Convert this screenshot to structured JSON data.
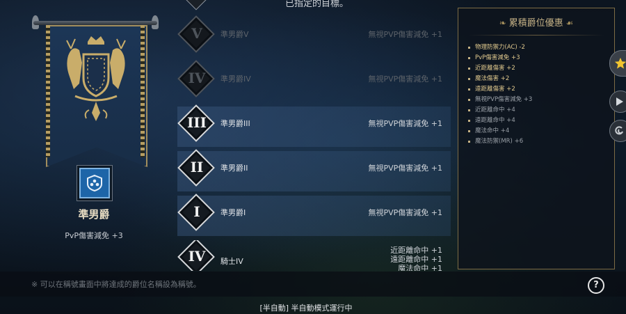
{
  "top": {
    "partial_text": "已指定的目標。"
  },
  "banner": {
    "rank_name": "準男爵",
    "rank_bonus": "PvP傷害減免 +3"
  },
  "ranks": [
    {
      "numeral": "V",
      "title": "準男爵V",
      "value": "無視PVP傷害減免 +1",
      "state": "dim"
    },
    {
      "numeral": "IV",
      "title": "準男爵IV",
      "value": "無視PVP傷害減免 +1",
      "state": "dim"
    },
    {
      "numeral": "III",
      "title": "準男爵III",
      "value": "無視PVP傷害減免 +1",
      "state": "active"
    },
    {
      "numeral": "II",
      "title": "準男爵II",
      "value": "無視PVP傷害減免 +1",
      "state": "active"
    },
    {
      "numeral": "I",
      "title": "準男爵I",
      "value": "無視PVP傷害減免 +1",
      "state": "active"
    },
    {
      "numeral": "IV",
      "title": "騎士IV",
      "value_lines": [
        "近距離命中 +1",
        "遠距離命中 +1",
        "魔法命中 +1"
      ],
      "state": "normal"
    }
  ],
  "panel": {
    "title": "累積爵位優惠",
    "items": [
      {
        "text": "物理防禦力(AC) -2",
        "tone": "gold"
      },
      {
        "text": "PvP傷害減免 +3",
        "tone": "gold"
      },
      {
        "text": "近距離傷害 +2",
        "tone": "gold"
      },
      {
        "text": "魔法傷害 +2",
        "tone": "gold"
      },
      {
        "text": "遠距離傷害 +2",
        "tone": "gold"
      },
      {
        "text": "無視PVP傷害減免 +3",
        "tone": "gray"
      },
      {
        "text": "近距離命中 +4",
        "tone": "gray"
      },
      {
        "text": "遠距離命中 +4",
        "tone": "gray"
      },
      {
        "text": "魔法命中 +4",
        "tone": "gray"
      },
      {
        "text": "魔法防禦(MR) +6",
        "tone": "gray"
      }
    ]
  },
  "hint": "※ 可以在稱號畫面中將達成的爵位名稱設為稱號。",
  "help_label": "?",
  "status": "[半自動] 半自動模式運行中",
  "colors": {
    "gold": "#e1c98e",
    "accent_blue": "#1d65a8",
    "frame_gold": "#7d6c45"
  }
}
